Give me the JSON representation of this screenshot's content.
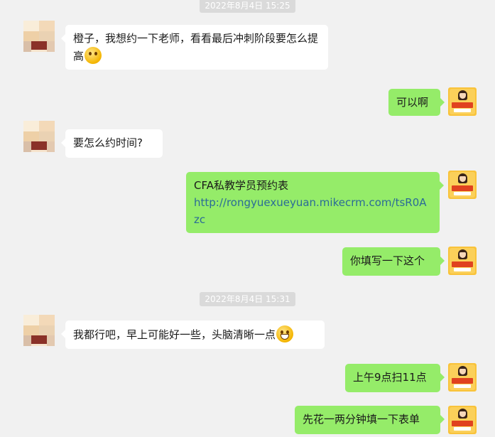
{
  "timestamps": [
    "2022年8月4日 15:25",
    "2022年8月4日 15:31"
  ],
  "messages": [
    {
      "side": "left",
      "text": "橙子，我想约一下老师，看看最后冲刺阶段要怎么提高",
      "emoji": "smirk-emoji"
    },
    {
      "side": "right",
      "text": "可以啊"
    },
    {
      "side": "left",
      "text": "要怎么约时间?"
    },
    {
      "side": "right",
      "text": "CFA私教学员预约表",
      "link": "http://rongyuexueyuan.mikecrm.com/tsR0Azc"
    },
    {
      "side": "right",
      "text": "你填写一下这个"
    },
    {
      "side": "left",
      "text": "我都行吧，早上可能好一些，头脑清晰一点",
      "emoji": "grin-emoji"
    },
    {
      "side": "right",
      "text": "上午9点扫11点"
    },
    {
      "side": "right",
      "text": "先花一两分钟填一下表单"
    }
  ],
  "colors": {
    "background": "#f1f1f1",
    "incoming_bubble": "#ffffff",
    "outgoing_bubble": "#95ec69",
    "link": "#2b6b97",
    "timestamp_bg": "#dadada"
  },
  "icons": {
    "left_avatar": "user-avatar",
    "right_avatar": "account-logo-avatar"
  }
}
